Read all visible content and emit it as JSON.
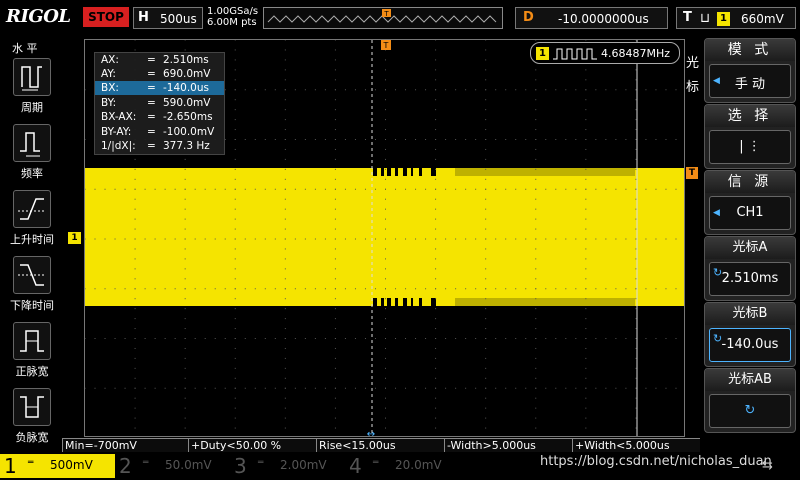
{
  "brand": "RIGOL",
  "run_state": "STOP",
  "horizontal": {
    "key": "H",
    "timebase": "500us"
  },
  "sample_rate": {
    "rate": "1.00GSa/s",
    "points": "6.00M pts"
  },
  "delay": {
    "key": "D",
    "value": "-10.0000000us"
  },
  "trigger": {
    "key": "T",
    "edge_symbol": "⊔",
    "channel": "1",
    "level": "660mV"
  },
  "left_menu": {
    "title": "水 平",
    "items": [
      {
        "label": "周期",
        "icon": "period-icon"
      },
      {
        "label": "频率",
        "icon": "frequency-icon"
      },
      {
        "label": "上升时间",
        "icon": "rise-time-icon"
      },
      {
        "label": "下降时间",
        "icon": "fall-time-icon"
      },
      {
        "label": "正脉宽",
        "icon": "positive-width-icon"
      },
      {
        "label": "负脉宽",
        "icon": "negative-width-icon"
      }
    ]
  },
  "cursor_table": {
    "rows": [
      {
        "key": "AX:",
        "value": "2.510ms"
      },
      {
        "key": "AY:",
        "value": "690.0mV"
      },
      {
        "key": "BX:",
        "value": "-140.0us"
      },
      {
        "key": "BY:",
        "value": "590.0mV"
      },
      {
        "key": "BX-AX:",
        "value": "-2.650ms"
      },
      {
        "key": "BY-AY:",
        "value": "-100.0mV"
      },
      {
        "key": "1/|dX|:",
        "value": "377.3 Hz"
      }
    ],
    "selected_row": 2
  },
  "frequency_counter": {
    "channel": "1",
    "value": "4.68487MHz"
  },
  "side_label": "光标",
  "ch1_marker": "1",
  "trigger_marker": "T",
  "right_menu": {
    "mode": {
      "title": "模 式",
      "value": "手 动"
    },
    "select": {
      "title": "选 择",
      "value": "| ⋮"
    },
    "source": {
      "title": "信 源",
      "value": "CH1"
    },
    "cursor_a": {
      "title": "光标A",
      "value": "2.510ms"
    },
    "cursor_b": {
      "title": "光标B",
      "value": "-140.0us"
    },
    "cursor_ab": {
      "title": "光标AB"
    }
  },
  "measurements": [
    "Min=-700mV",
    "+Duty<50.00 %",
    "Rise<15.00us",
    "-Width>5.000us",
    "+Width<5.000us"
  ],
  "channels": [
    {
      "num": "1",
      "coupling": "═",
      "scale": "500mV",
      "active": true,
      "color": "#f5e400"
    },
    {
      "num": "2",
      "coupling": "═",
      "scale": "50.0mV",
      "active": false,
      "color": "#00c8ff"
    },
    {
      "num": "3",
      "coupling": "═",
      "scale": "2.00mV",
      "active": false,
      "color": "#e040e0"
    },
    {
      "num": "4",
      "coupling": "═",
      "scale": "20.0mV",
      "active": false,
      "color": "#3060ff"
    }
  ],
  "watermark": "https://blog.csdn.net/nicholas_duan",
  "colors": {
    "ch1": "#f5e400",
    "trigger": "#f38c16",
    "cursor": "#4db4ff"
  }
}
